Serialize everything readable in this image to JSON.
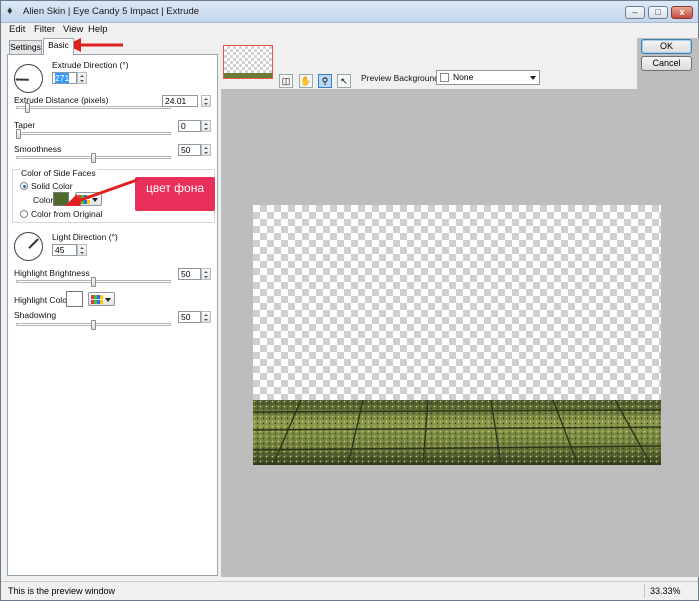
{
  "window": {
    "title": "Alien Skin | Eye Candy 5 Impact | Extrude",
    "minimize": "–",
    "maximize": "□",
    "close": "x"
  },
  "menu": [
    "Edit",
    "Filter",
    "View",
    "Help"
  ],
  "tabs": {
    "settings": "Settings",
    "basic": "Basic"
  },
  "basic": {
    "extrude_direction": {
      "label": "Extrude Direction (°)",
      "value": "271"
    },
    "extrude_distance": {
      "label": "Extrude Distance (pixels)",
      "value": "24.01",
      "fraction": 0.06
    },
    "taper": {
      "label": "Taper",
      "value": "0",
      "fraction": 0.0
    },
    "smoothness": {
      "label": "Smoothness",
      "value": "50",
      "fraction": 0.5
    },
    "side_faces": {
      "group_label": "Color of Side Faces",
      "solid_label": "Solid Color",
      "color_label": "Color",
      "color_value": "#4f6a2c",
      "from_original_label": "Color from Original"
    },
    "light_direction": {
      "label": "Light Direction (°)",
      "value": "45"
    },
    "highlight_brightness": {
      "label": "Highlight Brightness",
      "value": "50",
      "fraction": 0.5
    },
    "highlight_color": {
      "label": "Highlight Color",
      "value": "#ffffff"
    },
    "shadowing": {
      "label": "Shadowing",
      "value": "50",
      "fraction": 0.5
    }
  },
  "annotation": {
    "text": "цвет фона",
    "color": "#e8305a"
  },
  "preview": {
    "background_label": "Preview Background:",
    "background_value": "None"
  },
  "buttons": {
    "ok": "OK",
    "cancel": "Cancel"
  },
  "status": {
    "text": "This is the preview window",
    "zoom": "33.33%"
  }
}
